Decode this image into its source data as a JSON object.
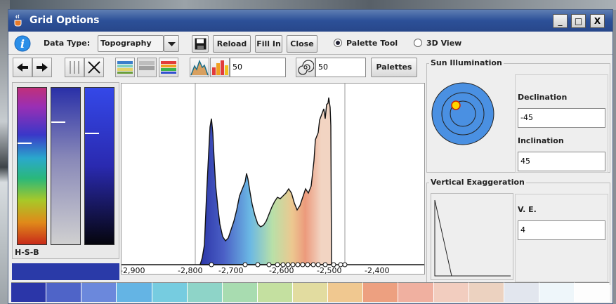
{
  "window": {
    "title": "Grid Options",
    "controls": {
      "minimize": "_",
      "maximize": "□",
      "close": "X"
    }
  },
  "toolbar": {
    "data_type_label": "Data Type:",
    "data_type_value": "Topography",
    "reload_label": "Reload",
    "fill_in_label": "Fill In",
    "close_label": "Close",
    "palette_tool_label": "Palette Tool",
    "view_3d_label": "3D View",
    "palette_tool_selected": true
  },
  "tools": {
    "field1_value": "50",
    "field2_value": "50",
    "palettes_label": "Palettes"
  },
  "color_panel": {
    "label": "H-S-B",
    "hue_marker": 0.35,
    "saturation_marker": 0.22,
    "brightness_marker": 0.29
  },
  "histogram": {
    "tick_labels": [
      "-2,900",
      "-2,800",
      "-2,700",
      "-2,600",
      "-2,500",
      "-2,400"
    ],
    "range_low": -2800,
    "range_high": -2500
  },
  "sun_illumination": {
    "title": "Sun Illumination",
    "declination_label": "Declination",
    "declination_value": "-45",
    "inclination_label": "Inclination",
    "inclination_value": "45"
  },
  "vertical_exaggeration": {
    "title": "Vertical Exaggeration",
    "ve_label": "V. E.",
    "ve_value": "4"
  },
  "swatch_colors": [
    "#2b36a8",
    "#4f64c8",
    "#6b88dc",
    "#64b4e4",
    "#76cce0",
    "#8ed4c8",
    "#a8dcb0",
    "#c4e0a0",
    "#e2dca0",
    "#f0c890",
    "#eda080",
    "#f0b0a0",
    "#f2cdbf",
    "#ecd2c0",
    "#e2e6ee",
    "#eef6fa",
    "#fdfdfd"
  ],
  "brand_color": "#2c5098"
}
